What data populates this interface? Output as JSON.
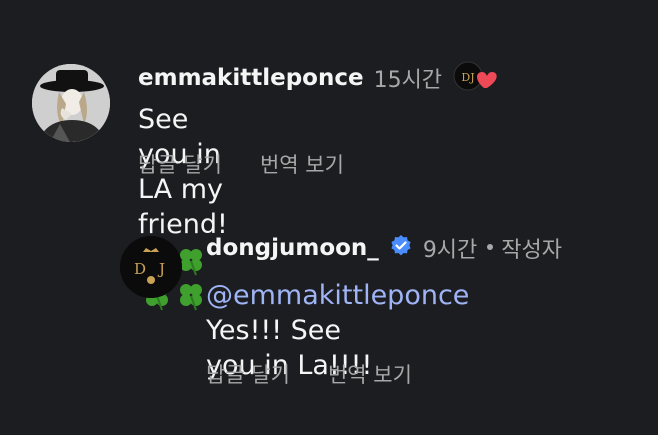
{
  "comments": [
    {
      "username": "emmakittleponce",
      "time": "15시간",
      "text": "See you in LA my friend!",
      "emoji_count": 4,
      "reply_label": "답글 달기",
      "translate_label": "번역 보기",
      "liked_by_creator": true
    },
    {
      "username": "dongjumoon_",
      "verified": true,
      "time": "9시간",
      "author_tag": "작성자",
      "mention": "@emmakittleponce",
      "text_line1": " Yes!!! See",
      "text_line2": "you in La!!!!",
      "reply_label": "답글 달기",
      "translate_label": "번역 보기"
    }
  ],
  "colors": {
    "background": "#1c1d21",
    "mention": "#9fb4f5",
    "verified": "#4a8dff",
    "heart": "#ed4956",
    "clover": "#3fa02e"
  },
  "icons": [
    "verified-badge-icon",
    "heart-icon",
    "four-leaf-clover-icon",
    "avatar-monogram"
  ]
}
